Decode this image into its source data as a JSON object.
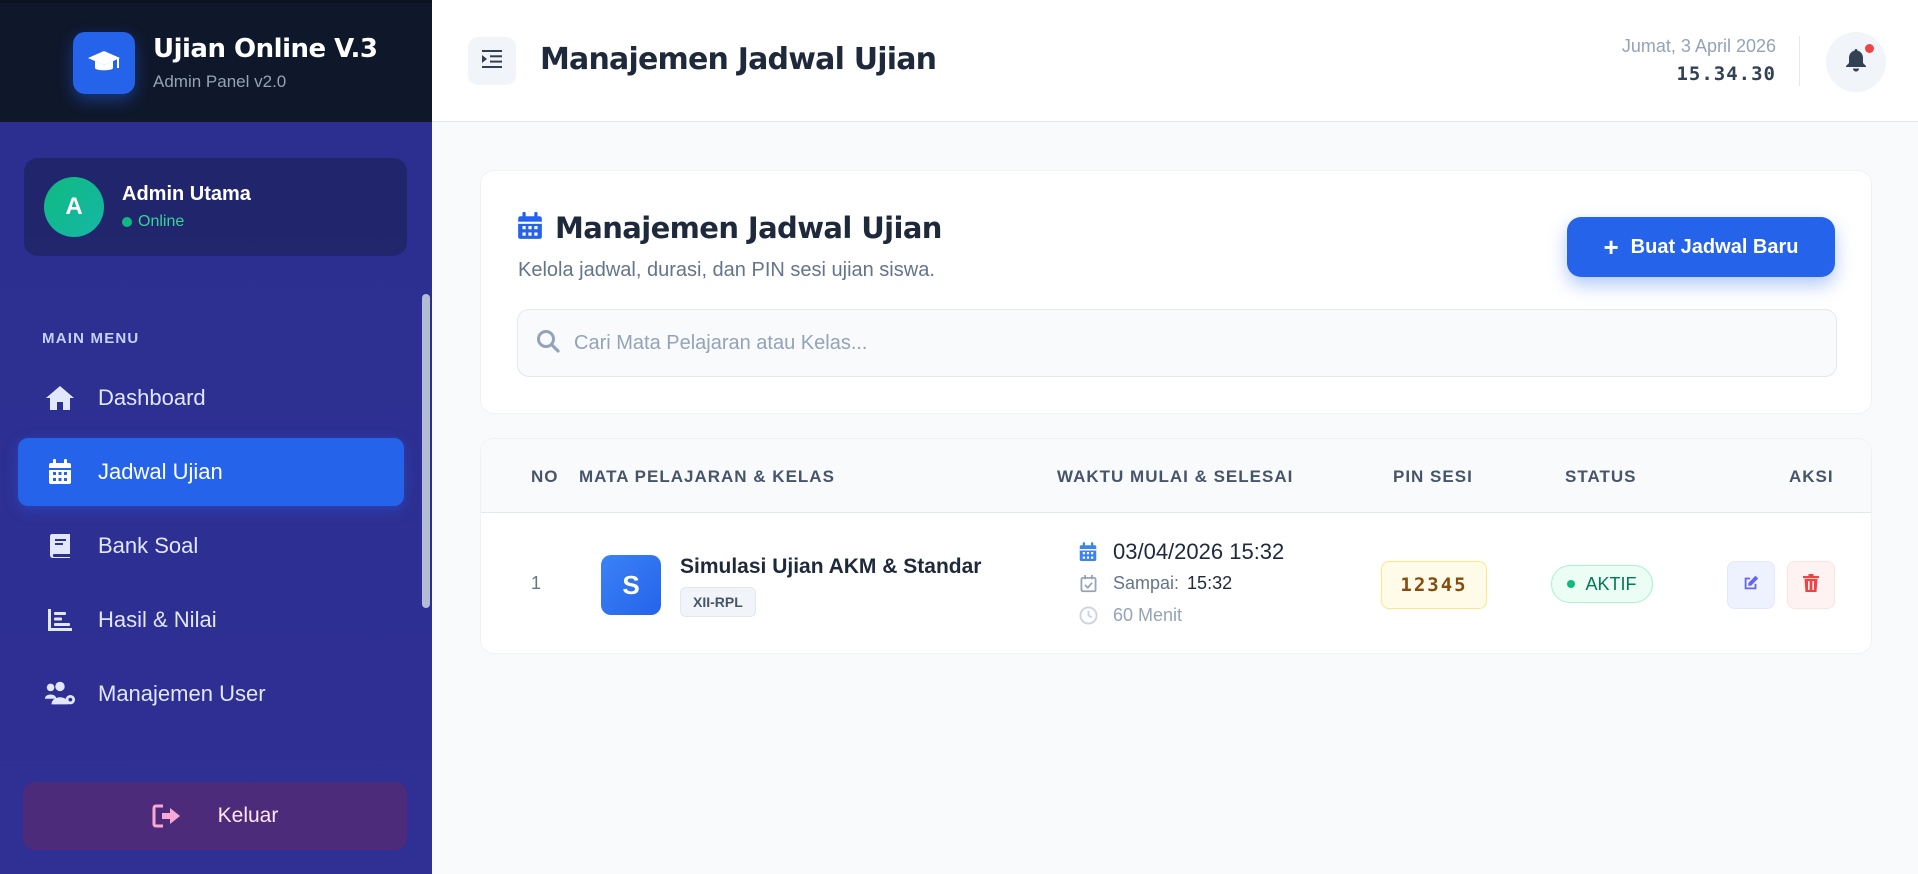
{
  "brand": {
    "title": "Ujian Online V.3",
    "subtitle": "Admin Panel v2.0"
  },
  "user": {
    "initial": "A",
    "name": "Admin Utama",
    "status": "Online"
  },
  "menu": {
    "section_label": "MAIN MENU",
    "items": [
      {
        "label": "Dashboard",
        "icon": "home-icon",
        "active": false
      },
      {
        "label": "Jadwal Ujian",
        "icon": "calendar-icon",
        "active": true
      },
      {
        "label": "Bank Soal",
        "icon": "book-icon",
        "active": false
      },
      {
        "label": "Hasil & Nilai",
        "icon": "chart-icon",
        "active": false
      },
      {
        "label": "Manajemen User",
        "icon": "users-gear-icon",
        "active": false
      }
    ],
    "logout_label": "Keluar"
  },
  "header": {
    "title": "Manajemen Jadwal Ujian",
    "date": "Jumat, 3 April 2026",
    "time": "15.34.30"
  },
  "page": {
    "title": "Manajemen Jadwal Ujian",
    "subtitle": "Kelola jadwal, durasi, dan PIN sesi ujian siswa.",
    "create_button": "Buat Jadwal Baru",
    "search_placeholder": "Cari Mata Pelajaran atau Kelas..."
  },
  "table": {
    "headers": {
      "no": "NO",
      "subject": "MATA PELAJARAN & KELAS",
      "time": "WAKTU MULAI & SELESAI",
      "pin": "PIN SESI",
      "status": "STATUS",
      "action": "AKSI"
    },
    "rows": [
      {
        "no": "1",
        "initial": "S",
        "subject": "Simulasi Ujian AKM & Standar",
        "class": "XII-RPL",
        "start": "03/04/2026 15:32",
        "end_label": "Sampai:",
        "end": "15:32",
        "duration": "60 Menit",
        "pin": "12345",
        "status": "AKTIF"
      }
    ]
  },
  "colors": {
    "primary": "#2563eb",
    "sidebar": "#2e3192",
    "brand_bg": "#0f172a",
    "success": "#10b981",
    "danger": "#ef4444"
  }
}
